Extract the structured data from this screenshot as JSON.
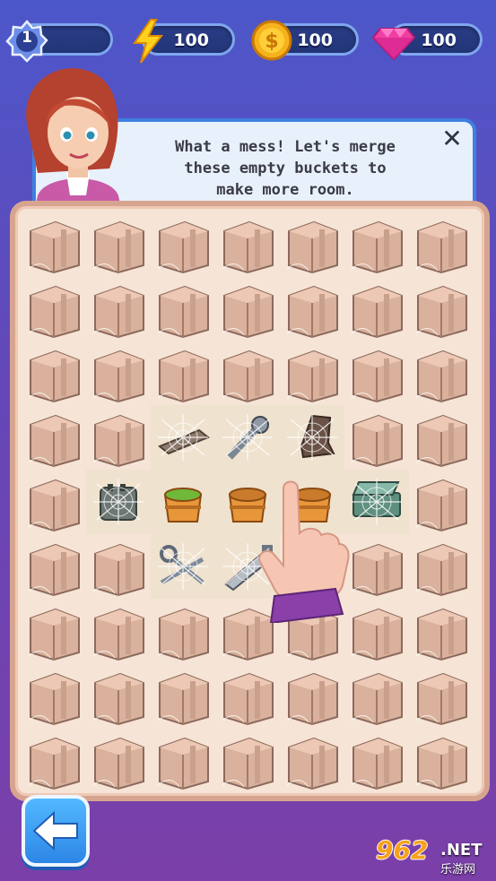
{
  "hud": {
    "level": "1",
    "energy": "100",
    "coins": "100",
    "gems": "100"
  },
  "dialog": {
    "line1": "What a mess! Let's merge",
    "line2": "these empty buckets to",
    "line3": "make more room.",
    "close_label": "✕"
  },
  "board": {
    "rows": [
      [
        "box",
        "box",
        "box",
        "box",
        "box",
        "box",
        "box"
      ],
      [
        "box",
        "box",
        "box",
        "box",
        "box",
        "box",
        "box"
      ],
      [
        "box",
        "box",
        "box",
        "box",
        "box",
        "box",
        "box"
      ],
      [
        "box",
        "box",
        "plank",
        "screw",
        "boot",
        "box",
        "box"
      ],
      [
        "box",
        "toaster",
        "bucket-green",
        "bucket-empty",
        "bucket-empty",
        "stove",
        "box"
      ],
      [
        "box",
        "box",
        "keys",
        "saw",
        "box",
        "box",
        "box"
      ],
      [
        "box",
        "box",
        "box",
        "box",
        "box",
        "box",
        "box"
      ],
      [
        "box",
        "box",
        "box",
        "box",
        "box",
        "box",
        "box"
      ],
      [
        "box",
        "box",
        "box",
        "box",
        "box",
        "box",
        "box"
      ]
    ]
  },
  "tutorial": {
    "hint": "hand-pointer-icon"
  },
  "back_button": {
    "icon": "arrow-left-icon"
  },
  "watermark": {
    "num": "962",
    "net": ".NET",
    "cn": "乐游网"
  },
  "colors": {
    "accent": "#3f80e0",
    "board_bg": "#f6e4d6",
    "board_border": "#d7a58f",
    "box": "#d9b19c"
  }
}
